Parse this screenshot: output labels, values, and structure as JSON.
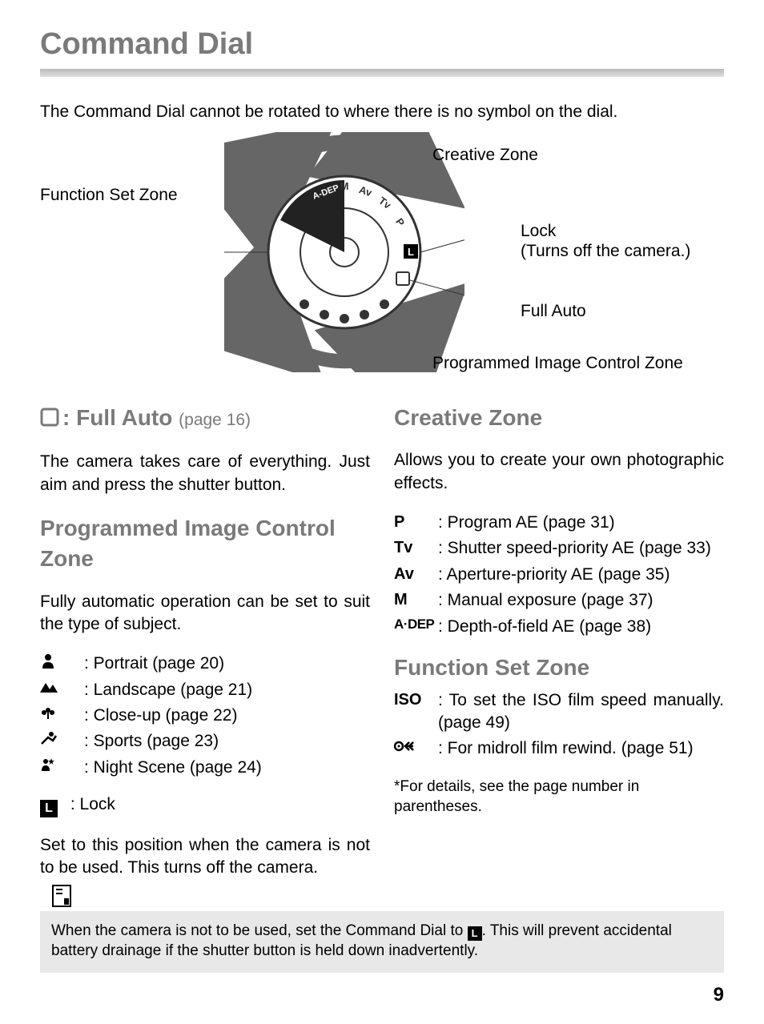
{
  "title": "Command Dial",
  "intro": "The Command Dial cannot be rotated to where there is no symbol on the dial.",
  "diagram": {
    "creative_zone": "Creative Zone",
    "function_set_zone": "Function Set Zone",
    "lock": "Lock",
    "lock_sub": "(Turns off the camera.)",
    "full_auto": "Full Auto",
    "pic_zone": "Programmed Image Control Zone"
  },
  "full_auto": {
    "heading_text": ": Full Auto",
    "page_ref": "(page 16)",
    "body": "The camera takes care of everything. Just aim and press the shutter button."
  },
  "pic_zone": {
    "heading": "Programmed Image Control Zone",
    "body": "Fully automatic operation can be set to suit the type of subject.",
    "items": [
      {
        "label": ": Portrait (page 20)"
      },
      {
        "label": ": Landscape (page 21)"
      },
      {
        "label": ": Close-up (page 22)"
      },
      {
        "label": ": Sports (page 23)"
      },
      {
        "label": ": Night Scene (page 24)"
      }
    ]
  },
  "lock": {
    "label": ": Lock",
    "body": "Set to this position when the camera is not to be used. This turns off the camera."
  },
  "creative_zone": {
    "heading": "Creative Zone",
    "body": "Allows you to create your own photographic effects.",
    "items": [
      {
        "sym": "P",
        "label": ": Program AE (page 31)"
      },
      {
        "sym": "Tv",
        "label": ": Shutter speed-priority AE (page 33)"
      },
      {
        "sym": "Av",
        "label": ": Aperture-priority AE (page 35)"
      },
      {
        "sym": "M",
        "label": ": Manual exposure (page 37)"
      },
      {
        "sym": "A·DEP",
        "label": ": Depth-of-field AE (page 38)"
      }
    ]
  },
  "function_set": {
    "heading": "Function Set Zone",
    "items": [
      {
        "sym": "ISO",
        "label": ": To set the ISO film speed manually. (page 49)"
      },
      {
        "label": ": For midroll film rewind. (page 51)"
      }
    ]
  },
  "footnote": "*For details, see the page number in parentheses.",
  "tip_pre": "When the camera is not to be used, set the Command Dial to ",
  "tip_post": ". This will prevent accidental battery drainage if the shutter button is held down inadvertently.",
  "page_number": "9"
}
